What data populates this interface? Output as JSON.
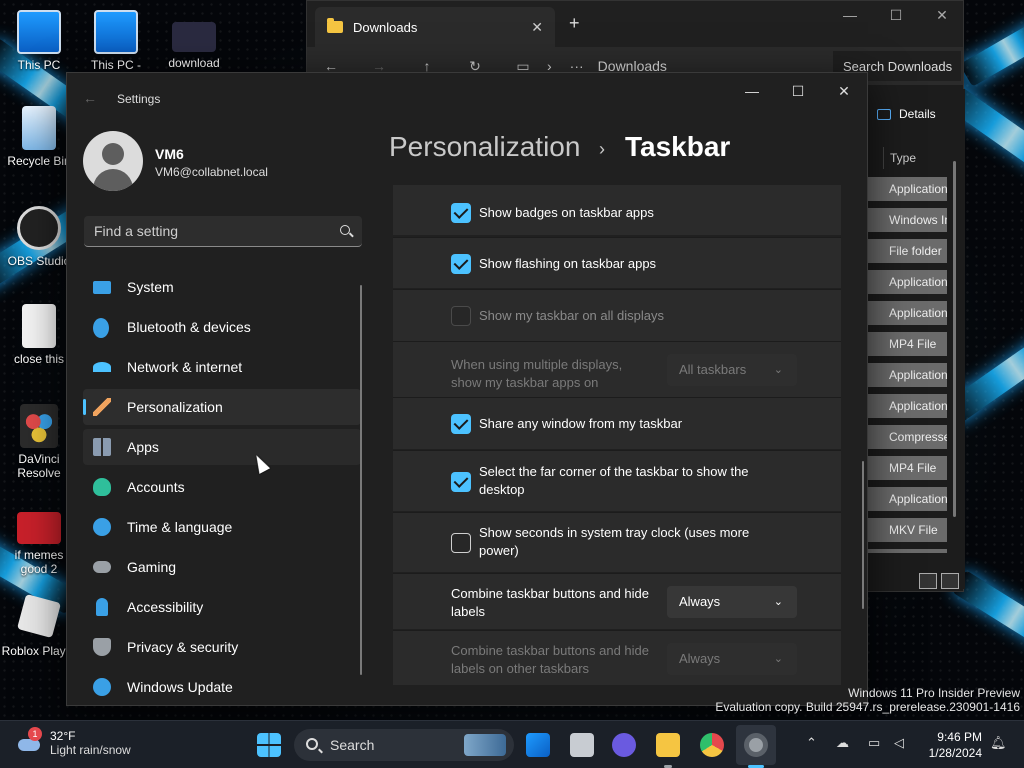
{
  "desktop": {
    "icons": [
      {
        "label": "This PC"
      },
      {
        "label": "This PC -"
      },
      {
        "label": "download"
      },
      {
        "label": "Recycle Bin"
      },
      {
        "label": "OBS Studio"
      },
      {
        "label": "close this"
      },
      {
        "label": "DaVinci Resolve"
      },
      {
        "label": "if memes good 2"
      },
      {
        "label": "Roblox Player"
      }
    ],
    "watermark": {
      "line1": "Windows 11 Pro Insider Preview",
      "line2": "Evaluation copy. Build 25947.rs_prerelease.230901-1416"
    }
  },
  "explorer": {
    "tab_title": "Downloads",
    "address": "Downloads",
    "search_placeholder": "Search Downloads",
    "details_label": "Details",
    "column_header": "Type",
    "types": [
      "Application",
      "Windows In",
      "File folder",
      "Application",
      "Application",
      "MP4 File",
      "Application",
      "Application",
      "Compressed",
      "MP4 File",
      "Application",
      "MKV File"
    ]
  },
  "settings": {
    "window_title": "Settings",
    "profile": {
      "name": "VM6",
      "email": "VM6@collabnet.local"
    },
    "search_placeholder": "Find a setting",
    "nav": [
      {
        "label": "System",
        "icon": "monitor-icon",
        "color": "#3aa0e6"
      },
      {
        "label": "Bluetooth & devices",
        "icon": "bluetooth-icon",
        "color": "#3aa0e6"
      },
      {
        "label": "Network & internet",
        "icon": "wifi-icon",
        "color": "#4cc2ff"
      },
      {
        "label": "Personalization",
        "icon": "brush-icon",
        "color": "#f0a35e"
      },
      {
        "label": "Apps",
        "icon": "apps-icon",
        "color": "#8a9bb0"
      },
      {
        "label": "Accounts",
        "icon": "person-icon",
        "color": "#2fbf9b"
      },
      {
        "label": "Time & language",
        "icon": "globe-clock-icon",
        "color": "#3aa0e6"
      },
      {
        "label": "Gaming",
        "icon": "gamepad-icon",
        "color": "#9aa0a6"
      },
      {
        "label": "Accessibility",
        "icon": "accessibility-icon",
        "color": "#3aa0e6"
      },
      {
        "label": "Privacy & security",
        "icon": "shield-icon",
        "color": "#9aa0a6"
      },
      {
        "label": "Windows Update",
        "icon": "update-icon",
        "color": "#3aa0e6"
      }
    ],
    "selected_nav": "Personalization",
    "breadcrumb": {
      "parent": "Personalization",
      "separator": "›",
      "current": "Taskbar"
    },
    "options": {
      "badges": {
        "label": "Show badges on taskbar apps",
        "checked": true
      },
      "flashing": {
        "label": "Show flashing on taskbar apps",
        "checked": true
      },
      "all_displays": {
        "label": "Show my taskbar on all displays",
        "checked": false,
        "disabled": true
      },
      "multi_display": {
        "label": "When using multiple displays, show my taskbar apps on",
        "value": "All taskbars",
        "disabled": true
      },
      "share_window": {
        "label": "Share any window from my taskbar",
        "checked": true
      },
      "far_corner": {
        "label": "Select the far corner of the taskbar to show the desktop",
        "checked": true
      },
      "seconds": {
        "label": "Show seconds in system tray clock (uses more power)",
        "checked": false
      },
      "combine": {
        "label": "Combine taskbar buttons and hide labels",
        "value": "Always"
      },
      "combine_other": {
        "label": "Combine taskbar buttons and hide labels on other taskbars",
        "value": "Always",
        "disabled": true
      }
    }
  },
  "taskbar": {
    "weather": {
      "temp": "32°F",
      "condition": "Light rain/snow",
      "badge": "1"
    },
    "search_label": "Search",
    "time": "9:46 PM",
    "date": "1/28/2024"
  },
  "colors": {
    "accent": "#4cc2ff"
  }
}
